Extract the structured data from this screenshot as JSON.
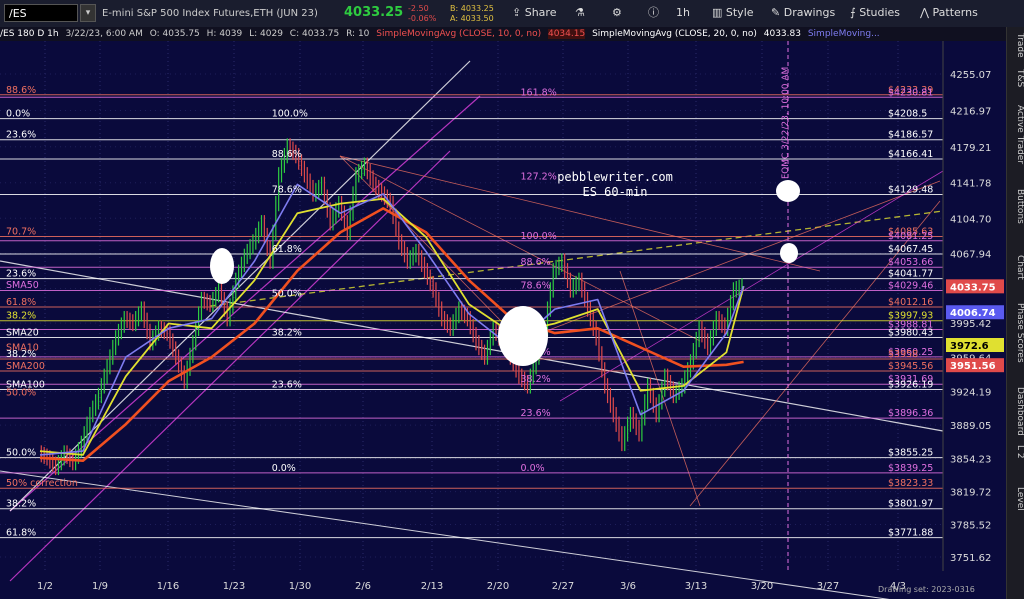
{
  "toolbar": {
    "symbol": "/ES",
    "description": "E-mini S&P 500 Index Futures,ETH (JUN 23)",
    "last": "4033.25",
    "change": "-2.50",
    "change_pct": "-0.06%",
    "bid": "B: 4033.25",
    "ask": "A: 4033.50",
    "share": "Share",
    "timeframe": "1h",
    "style": "Style",
    "drawings": "Drawings",
    "studies": "Studies",
    "patterns": "Patterns"
  },
  "status": {
    "symbol_info": "/ES 180 D 1h",
    "date": "3/22/23, 6:00 AM",
    "open": "O: 4035.75",
    "high": "H: 4039",
    "low": "L: 4029",
    "close": "C: 4033.75",
    "range": "R: 10",
    "sma10_label": "SimpleMovingAvg (CLOSE, 10, 0, no)",
    "sma10_value": "4034.15",
    "sma20_label": "SimpleMovingAvg (CLOSE, 20, 0, no)",
    "sma20_value": "4033.83",
    "sma_trunc": "SimpleMoving..."
  },
  "sidebar": [
    "Trade",
    "T&S",
    "Active Trader",
    "Buttons",
    "Chart",
    "Phase Scores",
    "Dashboard",
    "L 2",
    "Level"
  ],
  "footer": "Drawing set: 2023-0316",
  "chart_data": {
    "type": "line",
    "watermark": [
      "pebblewriter.com",
      "ES 60-min"
    ],
    "fomc_note": "FOMC 3/22/23, 10:00 AM",
    "x_ticks": [
      "1/2",
      "1/9",
      "1/16",
      "1/23",
      "1/30",
      "2/6",
      "2/13",
      "2/20",
      "2/27",
      "3/6",
      "3/13",
      "3/20",
      "3/27",
      "4/3"
    ],
    "y_ticks": [
      4255.07,
      4216.97,
      4179.21,
      4141.78,
      4104.7,
      4067.94,
      4031.49,
      3995.42,
      3959.64,
      3924.19,
      3889.05,
      3854.23,
      3819.72,
      3785.52,
      3751.62
    ],
    "ylim": [
      3740,
      4275
    ],
    "colors": {
      "up": "#2ecc40",
      "down": "#e04a4a",
      "sma10": "#7e7cf0",
      "sma20": "#e0e030",
      "sma50": "#e0e030",
      "sma100": "#ffffff",
      "sma200": "#f05020",
      "channel": "#e040e0",
      "fib": "#ffffff"
    },
    "close_series": [
      {
        "x": 0.0,
        "y": 3860
      },
      {
        "x": 0.6,
        "y": 3855
      },
      {
        "x": 1.2,
        "y": 3845
      },
      {
        "x": 1.8,
        "y": 3860
      },
      {
        "x": 2.4,
        "y": 3850
      },
      {
        "x": 3.0,
        "y": 3870
      },
      {
        "x": 3.6,
        "y": 3900
      },
      {
        "x": 4.2,
        "y": 3920
      },
      {
        "x": 4.8,
        "y": 3950
      },
      {
        "x": 5.4,
        "y": 3980
      },
      {
        "x": 6.0,
        "y": 4000
      },
      {
        "x": 6.6,
        "y": 3995
      },
      {
        "x": 7.2,
        "y": 4010
      },
      {
        "x": 7.8,
        "y": 3975
      },
      {
        "x": 8.4,
        "y": 3990
      },
      {
        "x": 9.0,
        "y": 3985
      },
      {
        "x": 9.6,
        "y": 3960
      },
      {
        "x": 10.2,
        "y": 3935
      },
      {
        "x": 10.8,
        "y": 3975
      },
      {
        "x": 11.4,
        "y": 4020
      },
      {
        "x": 12.0,
        "y": 4015
      },
      {
        "x": 12.6,
        "y": 4030
      },
      {
        "x": 13.2,
        "y": 4000
      },
      {
        "x": 13.8,
        "y": 4040
      },
      {
        "x": 14.4,
        "y": 4065
      },
      {
        "x": 15.0,
        "y": 4080
      },
      {
        "x": 15.6,
        "y": 4100
      },
      {
        "x": 16.2,
        "y": 4060
      },
      {
        "x": 16.8,
        "y": 4150
      },
      {
        "x": 17.4,
        "y": 4180
      },
      {
        "x": 18.0,
        "y": 4170
      },
      {
        "x": 18.6,
        "y": 4150
      },
      {
        "x": 19.2,
        "y": 4130
      },
      {
        "x": 19.8,
        "y": 4140
      },
      {
        "x": 20.4,
        "y": 4100
      },
      {
        "x": 21.0,
        "y": 4120
      },
      {
        "x": 21.6,
        "y": 4090
      },
      {
        "x": 22.2,
        "y": 4150
      },
      {
        "x": 22.8,
        "y": 4160
      },
      {
        "x": 23.4,
        "y": 4140
      },
      {
        "x": 24.0,
        "y": 4130
      },
      {
        "x": 24.6,
        "y": 4120
      },
      {
        "x": 25.2,
        "y": 4080
      },
      {
        "x": 25.8,
        "y": 4060
      },
      {
        "x": 26.4,
        "y": 4070
      },
      {
        "x": 27.0,
        "y": 4050
      },
      {
        "x": 27.6,
        "y": 4030
      },
      {
        "x": 28.2,
        "y": 4000
      },
      {
        "x": 28.8,
        "y": 3990
      },
      {
        "x": 29.4,
        "y": 4010
      },
      {
        "x": 30.0,
        "y": 4000
      },
      {
        "x": 30.6,
        "y": 3975
      },
      {
        "x": 31.2,
        "y": 3960
      },
      {
        "x": 31.8,
        "y": 3990
      },
      {
        "x": 32.4,
        "y": 3975
      },
      {
        "x": 33.0,
        "y": 3960
      },
      {
        "x": 33.6,
        "y": 3940
      },
      {
        "x": 34.2,
        "y": 3930
      },
      {
        "x": 34.8,
        "y": 3960
      },
      {
        "x": 35.4,
        "y": 3990
      },
      {
        "x": 36.0,
        "y": 4050
      },
      {
        "x": 36.6,
        "y": 4060
      },
      {
        "x": 37.2,
        "y": 4030
      },
      {
        "x": 37.8,
        "y": 4040
      },
      {
        "x": 38.4,
        "y": 4010
      },
      {
        "x": 39.0,
        "y": 3980
      },
      {
        "x": 39.6,
        "y": 3930
      },
      {
        "x": 40.2,
        "y": 3900
      },
      {
        "x": 40.8,
        "y": 3870
      },
      {
        "x": 41.4,
        "y": 3900
      },
      {
        "x": 42.0,
        "y": 3880
      },
      {
        "x": 42.6,
        "y": 3930
      },
      {
        "x": 43.2,
        "y": 3900
      },
      {
        "x": 43.8,
        "y": 3940
      },
      {
        "x": 44.4,
        "y": 3920
      },
      {
        "x": 45.0,
        "y": 3930
      },
      {
        "x": 45.6,
        "y": 3955
      },
      {
        "x": 46.2,
        "y": 3990
      },
      {
        "x": 46.8,
        "y": 3970
      },
      {
        "x": 47.4,
        "y": 4000
      },
      {
        "x": 48.0,
        "y": 3990
      },
      {
        "x": 48.6,
        "y": 4030
      },
      {
        "x": 49.2,
        "y": 4034
      }
    ],
    "sma10": [
      {
        "x": 0,
        "y": 3858
      },
      {
        "x": 3,
        "y": 3862
      },
      {
        "x": 6,
        "y": 3960
      },
      {
        "x": 9,
        "y": 3990
      },
      {
        "x": 12,
        "y": 4000
      },
      {
        "x": 15,
        "y": 4060
      },
      {
        "x": 18,
        "y": 4140
      },
      {
        "x": 21,
        "y": 4110
      },
      {
        "x": 24,
        "y": 4130
      },
      {
        "x": 27,
        "y": 4070
      },
      {
        "x": 30,
        "y": 4005
      },
      {
        "x": 33,
        "y": 3970
      },
      {
        "x": 36,
        "y": 4010
      },
      {
        "x": 39,
        "y": 4020
      },
      {
        "x": 42,
        "y": 3900
      },
      {
        "x": 45,
        "y": 3925
      },
      {
        "x": 48,
        "y": 3985
      },
      {
        "x": 49.2,
        "y": 4034
      }
    ],
    "sma20": [
      {
        "x": 0,
        "y": 3862
      },
      {
        "x": 3,
        "y": 3858
      },
      {
        "x": 6,
        "y": 3940
      },
      {
        "x": 9,
        "y": 3995
      },
      {
        "x": 12,
        "y": 3990
      },
      {
        "x": 15,
        "y": 4040
      },
      {
        "x": 18,
        "y": 4110
      },
      {
        "x": 21,
        "y": 4120
      },
      {
        "x": 24,
        "y": 4125
      },
      {
        "x": 27,
        "y": 4085
      },
      {
        "x": 30,
        "y": 4015
      },
      {
        "x": 33,
        "y": 3985
      },
      {
        "x": 36,
        "y": 3995
      },
      {
        "x": 39,
        "y": 4010
      },
      {
        "x": 42,
        "y": 3925
      },
      {
        "x": 45,
        "y": 3930
      },
      {
        "x": 48,
        "y": 3965
      },
      {
        "x": 49.2,
        "y": 4034
      }
    ],
    "sma200": [
      {
        "x": 0,
        "y": 3855
      },
      {
        "x": 3,
        "y": 3852
      },
      {
        "x": 6,
        "y": 3890
      },
      {
        "x": 9,
        "y": 3935
      },
      {
        "x": 12,
        "y": 3960
      },
      {
        "x": 15,
        "y": 3995
      },
      {
        "x": 18,
        "y": 4050
      },
      {
        "x": 21,
        "y": 4090
      },
      {
        "x": 24,
        "y": 4115
      },
      {
        "x": 27,
        "y": 4090
      },
      {
        "x": 30,
        "y": 4040
      },
      {
        "x": 33,
        "y": 4000
      },
      {
        "x": 36,
        "y": 3985
      },
      {
        "x": 39,
        "y": 3990
      },
      {
        "x": 42,
        "y": 3970
      },
      {
        "x": 45,
        "y": 3950
      },
      {
        "x": 48,
        "y": 3952
      },
      {
        "x": 49.2,
        "y": 3955
      }
    ],
    "h_levels": [
      {
        "y": 4233.39,
        "label": "$4233.39",
        "color": "#f07060"
      },
      {
        "y": 4230.81,
        "label": "$4230.81",
        "color": "#e070e0"
      },
      {
        "y": 4208.5,
        "label": "$4208.5",
        "color": "#ffffff"
      },
      {
        "y": 4186.57,
        "label": "$4186.57",
        "color": "#ffffff"
      },
      {
        "y": 4166.41,
        "label": "$4166.41",
        "color": "#ffffff"
      },
      {
        "y": 4129.48,
        "label": "$4129.48",
        "color": "#ffffff"
      },
      {
        "y": 4085.63,
        "label": "$4085.63",
        "color": "#f07060"
      },
      {
        "y": 4081.25,
        "label": "$4081.25",
        "color": "#e070e0"
      },
      {
        "y": 4067.45,
        "label": "$4067.45",
        "color": "#ffffff"
      },
      {
        "y": 4053.66,
        "label": "$4053.66",
        "color": "#e070e0"
      },
      {
        "y": 4041.77,
        "label": "$4041.77",
        "color": "#ffffff"
      },
      {
        "y": 4029.46,
        "label": "$4029.46",
        "color": "#e070e0"
      },
      {
        "y": 4012.16,
        "label": "$4012.16",
        "color": "#f07060"
      },
      {
        "y": 3997.93,
        "label": "$3997.93",
        "color": "#e0e030"
      },
      {
        "y": 3988.81,
        "label": "$3988.81",
        "color": "#e070e0"
      },
      {
        "y": 3980.43,
        "label": "$3980.43",
        "color": "#ffffff"
      },
      {
        "y": 3960.25,
        "label": "$3960.25",
        "color": "#e070e0"
      },
      {
        "y": 3958,
        "label": "$3958",
        "color": "#f07060"
      },
      {
        "y": 3945.56,
        "label": "$3945.56",
        "color": "#f07060"
      },
      {
        "y": 3931.69,
        "label": "$3931.69",
        "color": "#e070e0"
      },
      {
        "y": 3926.19,
        "label": "$3926.19",
        "color": "#ffffff"
      },
      {
        "y": 3896.36,
        "label": "$3896.36",
        "color": "#e070e0"
      },
      {
        "y": 3855.25,
        "label": "$3855.25",
        "color": "#ffffff"
      },
      {
        "y": 3839.25,
        "label": "$3839.25",
        "color": "#e070e0"
      },
      {
        "y": 3823.33,
        "label": "$3823.33",
        "color": "#f07060"
      },
      {
        "y": 3801.97,
        "label": "$3801.97",
        "color": "#ffffff"
      },
      {
        "y": 3771.88,
        "label": "$3771.88",
        "color": "#ffffff"
      }
    ],
    "left_labels": [
      {
        "y": 4233.39,
        "text": "88.6%",
        "color": "#f07060"
      },
      {
        "y": 4208.5,
        "text": "0.0%",
        "color": "#ffffff"
      },
      {
        "y": 4186.57,
        "text": "23.6%",
        "color": "#ffffff"
      },
      {
        "y": 4085.63,
        "text": "70.7%",
        "color": "#f07060"
      },
      {
        "y": 4041.77,
        "text": "23.6%",
        "color": "#ffffff"
      },
      {
        "y": 4030,
        "text": "SMA50",
        "color": "#e070e0"
      },
      {
        "y": 4012.16,
        "text": "61.8%",
        "color": "#f07060"
      },
      {
        "y": 3997.93,
        "text": "38.2%",
        "color": "#e0e030"
      },
      {
        "y": 3980.43,
        "text": "SMA20",
        "color": "#ffffff"
      },
      {
        "y": 3965,
        "text": "SMA10",
        "color": "#f07060"
      },
      {
        "y": 3958,
        "text": "38.2%",
        "color": "#ffffff"
      },
      {
        "y": 3945.56,
        "text": "SMA200",
        "color": "#f07060"
      },
      {
        "y": 3926.19,
        "text": "SMA100",
        "color": "#ffffff"
      },
      {
        "y": 3918,
        "text": "50.0%",
        "color": "#f07060"
      },
      {
        "y": 3855.25,
        "text": "50.0%",
        "color": "#ffffff"
      },
      {
        "y": 3823.33,
        "text": "50% correction",
        "color": "#f07060"
      },
      {
        "y": 3801.97,
        "text": "38.2%",
        "color": "#ffffff"
      },
      {
        "y": 3771.88,
        "text": "61.8%",
        "color": "#ffffff"
      }
    ],
    "fib_mid_labels": [
      {
        "x": 19,
        "y": 4208.5,
        "text": "100.0%",
        "color": "#ffffff"
      },
      {
        "x": 19,
        "y": 4166.41,
        "text": "88.6%",
        "color": "#ffffff"
      },
      {
        "x": 19,
        "y": 4129.48,
        "text": "78.6%",
        "color": "#ffffff"
      },
      {
        "x": 19,
        "y": 4067.45,
        "text": "61.8%",
        "color": "#ffffff"
      },
      {
        "x": 19,
        "y": 4021,
        "text": "50.0%",
        "color": "#ffffff"
      },
      {
        "x": 19,
        "y": 3980.43,
        "text": "38.2%",
        "color": "#ffffff"
      },
      {
        "x": 19,
        "y": 3926.19,
        "text": "23.6%",
        "color": "#ffffff"
      },
      {
        "x": 19,
        "y": 3839.25,
        "text": "0.0%",
        "color": "#ffffff"
      },
      {
        "x": 35,
        "y": 4230.81,
        "text": "161.8%",
        "color": "#e070e0"
      },
      {
        "x": 35,
        "y": 4143.07,
        "text": "127.2%",
        "color": "#e070e0"
      },
      {
        "x": 35,
        "y": 4081.25,
        "text": "100.0%",
        "color": "#e070e0"
      },
      {
        "x": 35,
        "y": 4053.66,
        "text": "88.6%",
        "color": "#e070e0"
      },
      {
        "x": 35,
        "y": 4029.46,
        "text": "78.6%",
        "color": "#e070e0"
      },
      {
        "x": 35,
        "y": 3960.25,
        "text": "50.0%",
        "color": "#e070e0"
      },
      {
        "x": 35,
        "y": 3931.69,
        "text": "38.2%",
        "color": "#e070e0"
      },
      {
        "x": 35,
        "y": 3896.36,
        "text": "23.6%",
        "color": "#e070e0"
      },
      {
        "x": 35,
        "y": 3839.25,
        "text": "0.0%",
        "color": "#e070e0"
      }
    ],
    "price_tags": [
      {
        "y": 4033.75,
        "label": "4033.75",
        "bg": "#e04a4a",
        "fg": "#ffffff"
      },
      {
        "y": 4006.74,
        "label": "4006.74",
        "bg": "#5a5af0",
        "fg": "#ffffff"
      },
      {
        "y": 3972.6,
        "label": "3972.6",
        "bg": "#e0e030",
        "fg": "#000000"
      },
      {
        "y": 3951.56,
        "label": "3951.56",
        "bg": "#e04a4a",
        "fg": "#ffffff"
      }
    ]
  }
}
